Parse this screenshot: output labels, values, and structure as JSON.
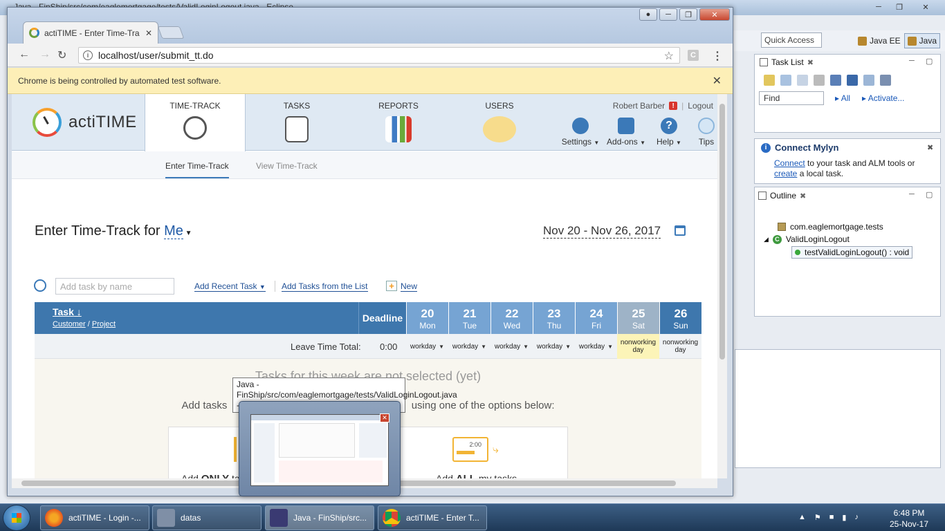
{
  "eclipse": {
    "title": "Java - FinShip/src/com/eaglemortgage/tests/ValidLoginLogout.java - Eclipse",
    "quick_access": "Quick Access",
    "perspectives": [
      "Java EE",
      "Java"
    ],
    "task_list": {
      "tab": "Task List",
      "find_placeholder": "Find",
      "all_link": "All",
      "activate_link": "Activate..."
    },
    "mylyn": {
      "title": "Connect Mylyn",
      "connect": "Connect",
      "text1": " to your task and ALM tools or",
      "create": "create",
      "text2": " a local task."
    },
    "outline": {
      "tab": "Outline",
      "package": "com.eaglemortgage.tests",
      "class": "ValidLoginLogout",
      "method": "testValidLoginLogout() : void"
    }
  },
  "chrome": {
    "tab_title": "actiTIME - Enter Time-Tra",
    "url": "localhost/user/submit_tt.do",
    "infobar": "Chrome is being controlled by automated test software.",
    "extension_label": "C"
  },
  "actitime": {
    "logo": "actiTIME",
    "nav": [
      {
        "label": "TIME-TRACK",
        "active": true
      },
      {
        "label": "TASKS"
      },
      {
        "label": "REPORTS"
      },
      {
        "label": "USERS"
      }
    ],
    "user_name": "Robert Barber",
    "user_badge": "!",
    "logout": "Logout",
    "tools": [
      "Settings",
      "Add-ons",
      "Help",
      "Tips"
    ],
    "subnav": [
      "Enter Time-Track",
      "View Time-Track"
    ],
    "title_prefix": "Enter Time-Track for",
    "title_who": "Me",
    "date_range": "Nov 20 - Nov 26, 2017",
    "task_input_placeholder": "Add task by name",
    "add_recent": "Add Recent Task",
    "add_from_list": "Add Tasks from the List",
    "new": "New",
    "table": {
      "task_header": "Task",
      "customer": "Customer",
      "project": "Project",
      "deadline": "Deadline",
      "days": [
        {
          "num": "20",
          "name": "Mon",
          "type": "workday"
        },
        {
          "num": "21",
          "name": "Tue",
          "type": "workday"
        },
        {
          "num": "22",
          "name": "Wed",
          "type": "workday"
        },
        {
          "num": "23",
          "name": "Thu",
          "type": "workday"
        },
        {
          "num": "24",
          "name": "Fri",
          "type": "workday"
        },
        {
          "num": "25",
          "name": "Sat",
          "type": "nonworking day"
        },
        {
          "num": "26",
          "name": "Sun",
          "type": "nonworking day"
        }
      ],
      "leave_label": "Leave Time Total:",
      "leave_value": "0:00"
    },
    "empty": {
      "title": "Tasks for this week are not selected (yet)",
      "sub_left": "Add tasks",
      "sub_right": "using one of the options below:",
      "opt_only_prefix": "Add",
      "opt_only_bold": "ONLY",
      "opt_only_suffix": "ta",
      "opt_all_prefix": "Add",
      "opt_all_bold": "ALL",
      "opt_all_suffix": "my tasks",
      "icon_time": "2:00",
      "icon_dash": "--"
    }
  },
  "taskbar": {
    "items": [
      "actiTIME - Login -...",
      "datas",
      "Java - FinShip/src...",
      "actiTIME - Enter T..."
    ],
    "time": "6:48 PM",
    "date": "25-Nov-17"
  },
  "thumbnail": {
    "tooltip": "Java - FinShip/src/com/eaglemortgage/tests/ValidLoginLogout.java - Eclipse"
  }
}
